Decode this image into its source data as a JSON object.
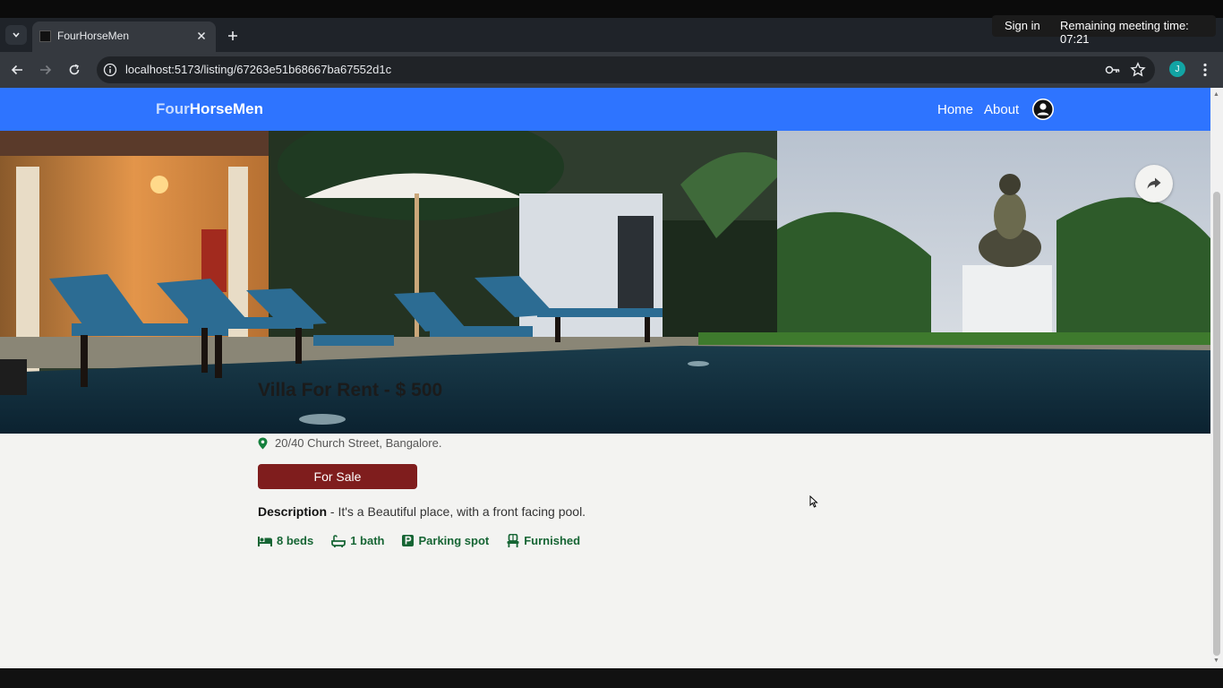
{
  "browser": {
    "tab_title": "FourHorseMen",
    "url": "localhost:5173/listing/67263e51b68667ba67552d1c",
    "profile_initial": "J"
  },
  "meeting": {
    "sign_in": "Sign in",
    "remaining_time": "Remaining meeting time: 07:21"
  },
  "site": {
    "brand_part1": "Four",
    "brand_part2": "HorseMen",
    "nav": {
      "home": "Home",
      "about": "About"
    },
    "brand_color": "#2e74ff"
  },
  "listing": {
    "title": "Villa For Rent - $ 500",
    "address": "20/40 Church Street, Bangalore.",
    "badge": "For Sale",
    "description_label": "Description",
    "description_text": " - It's a Beautiful place, with a front facing pool.",
    "features": {
      "beds": "8 beds",
      "baths": "1 bath",
      "parking": "Parking spot",
      "furnished": "Furnished"
    }
  }
}
